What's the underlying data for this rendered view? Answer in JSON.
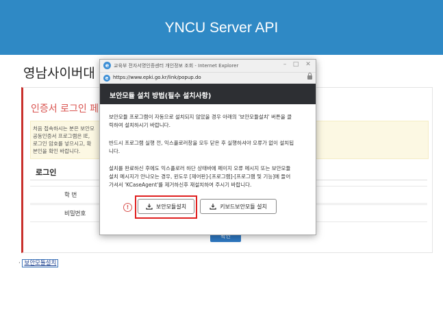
{
  "header": {
    "title": "YNCU Server API"
  },
  "page": {
    "heading": "영남사이버대",
    "card_title": "인증서 로그인 페",
    "notice_lines": [
      "처음 접속하시는 분은 보안모",
      "공동인증서 프로그램은 IE,",
      "로그인 암호를 넣으시고, 확",
      "본인을 확인 바랍니다."
    ],
    "login_label": "로그인",
    "rows": [
      {
        "label": "학      번"
      },
      {
        "label": "비밀번호"
      }
    ],
    "confirm_label": "확인",
    "bottom_link": "보안모듈설치"
  },
  "popup": {
    "window_title": "교육부 전자서명인증센터 개인정보 조회 - Internet Explorer",
    "url": "https://www.epki.go.kr/link/popup.do",
    "controls": {
      "minimize": "–",
      "maximize": "□",
      "close": "✕"
    },
    "header": "보안모듈 설치 방법(필수 설치사항)",
    "paragraphs": [
      [
        "보안모듈 프로그램이 자동으로 설치되지 않았을 경우 아래의 '보안모듈설치' 버튼을 클",
        "릭하여 설치하시기 바랍니다."
      ],
      [
        "반드시 프로그램 실행 전, 익스플로러창을 모두 닫은 후 실행하셔야 오류가 없이 설치됩",
        "니다."
      ],
      [
        "설치를 완료하신 후에도 익스플로러 하단 상태바에 페이지 오류 메시지 또는 보안모듈",
        "설치 메시지가 안나오는 경우, 윈도우 [제어판]-[프로그램]-[프로그램 및 기능]에 들어",
        "가셔서 'KCaseAgent'를 제거하신후 재설치하여 주시기 바랍니다."
      ]
    ],
    "buttons": {
      "install": "보안모듈설치",
      "keyboard": "키보드보안모듈 설치"
    },
    "warn_glyph": "!"
  },
  "colors": {
    "topbar": "#2f89c5",
    "card_accent": "#c9302c",
    "dialog_header": "#2d2f33",
    "highlight": "#e02020"
  }
}
